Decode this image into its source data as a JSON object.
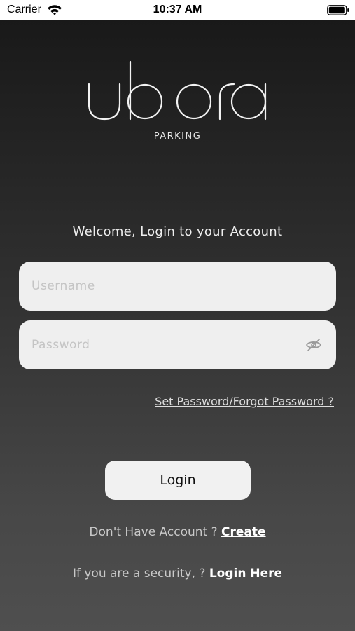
{
  "status_bar": {
    "carrier": "Carrier",
    "time": "10:37 AM"
  },
  "logo": {
    "wordmark": "ubora",
    "subtitle": "PARKING"
  },
  "welcome_text": "Welcome,  Login to  your Account",
  "form": {
    "username": {
      "placeholder": "Username",
      "value": ""
    },
    "password": {
      "placeholder": "Password",
      "value": ""
    },
    "forgot_link": "Set Password/Forgot Password ?",
    "login_button": "Login"
  },
  "footer": {
    "create_prompt": "Don't Have Account ? ",
    "create_link": "Create",
    "security_prompt": "If you are a security, ? ",
    "security_link": "Login Here"
  },
  "icons": {
    "wifi": "wifi-icon",
    "battery": "battery-icon",
    "password_toggle": "eye-off-icon"
  },
  "colors": {
    "background_top": "#191919",
    "background_bottom": "#4f4f4f",
    "field_bg": "#efefef",
    "button_bg": "#f1f1f1"
  }
}
